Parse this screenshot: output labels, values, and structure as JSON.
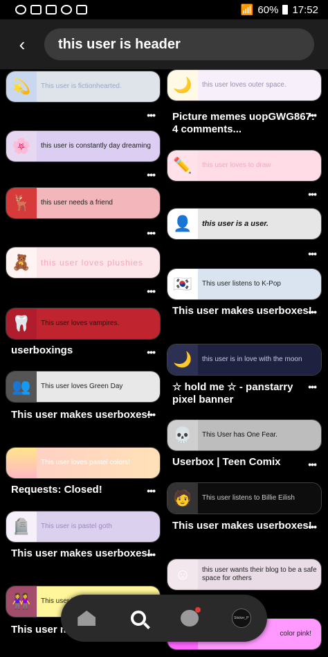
{
  "status": {
    "battery": "60%",
    "time": "17:52"
  },
  "header": {
    "search_value": "this user is header"
  },
  "left": [
    {
      "text": "This user is fictionhearted.",
      "title": ""
    },
    {
      "text": "this user is constantly day dreaming",
      "title": ""
    },
    {
      "text": "this user needs a friend",
      "title": ""
    },
    {
      "text": "this user loves plushies",
      "title": ""
    },
    {
      "text": "This user loves vampires.",
      "title": "userboxings"
    },
    {
      "text": "This user loves Green Day",
      "title": "This user makes userboxes!"
    },
    {
      "text": "This user loves pastel colors!",
      "title": "Requests: Closed!"
    },
    {
      "text": "This user is pastel goth",
      "title": "This user makes userboxes!"
    },
    {
      "text": "This user is... Defende...",
      "title": "This user m... userboxes!"
    }
  ],
  "right": [
    {
      "text": "this user loves outer space.",
      "title": "Picture memes uopGWG867: 4 comments..."
    },
    {
      "text": "this user loves to draw",
      "title": ""
    },
    {
      "text": "this user is a user.",
      "title": ""
    },
    {
      "text": "This user listens to K-Pop",
      "title": "This user makes userboxes!"
    },
    {
      "text": "this user is in love with the moon",
      "title": "☆ hold me ☆ - panstarry pixel banner"
    },
    {
      "text": "This User has One Fear.",
      "title": "Userbox | Teen Comix"
    },
    {
      "text": "This user listens to Billie Eilish",
      "title": "This user makes userboxes!"
    },
    {
      "text": "this user wants their blog to be a safe space for others",
      "title": ""
    },
    {
      "text": "color pink!",
      "title": ""
    }
  ],
  "nav": {
    "avatar_text": "Sticker_P"
  },
  "icons": [
    "back-arrow-icon",
    "home-icon",
    "search-icon",
    "chat-icon",
    "profile-avatar"
  ]
}
